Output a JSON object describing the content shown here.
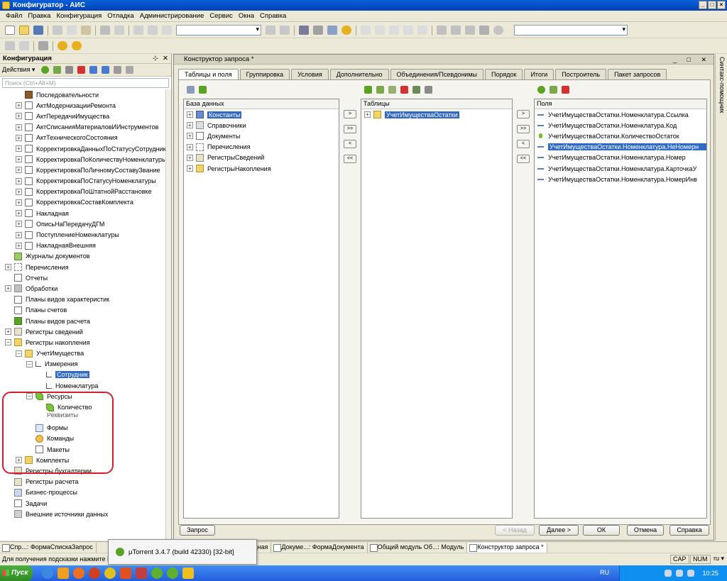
{
  "window": {
    "title": "Конфигуратор - АИС"
  },
  "menu": [
    "Файл",
    "Правка",
    "Конфигурация",
    "Отладка",
    "Администрирование",
    "Сервис",
    "Окна",
    "Справка"
  ],
  "left_panel": {
    "title": "Конфигурация",
    "actions_label": "Действия ▾",
    "search_placeholder": "Поиск (Ctrl+Alt+M)",
    "items": [
      "Последовательности",
      "АктМодернизацииРемонта",
      "АктПередачиИмущества",
      "АктСписанияМатериаловИИнструментов",
      "АктТехническогоСостояния",
      "КорректировкаДанныхПоСтатусуСотрудника",
      "КорректировкаПоКоличествуНоменклатуры",
      "КорректировкаПоЛичномуСоставуЗвание",
      "КорректировкаПоСтатусуНоменклатуры",
      "КорректировкаПоШтатнойРасстановке",
      "КорректировкаСоставКомплекта",
      "Накладная",
      "ОписьНаПередачуДГМ",
      "ПоступлениеНоменклатуры",
      "НакладнаяВнешняя",
      "Журналы документов",
      "Перечисления",
      "Отчеты",
      "Обработки",
      "Планы видов характеристик",
      "Планы счетов",
      "Планы видов расчета",
      "Регистры сведений",
      "Регистры накопления",
      "УчетИмущества",
      "Измерения",
      "Сотрудник",
      "Номенклатура",
      "Ресурсы",
      "Количество",
      "Реквизиты",
      "Формы",
      "Команды",
      "Макеты",
      "Комплекты",
      "Регистры бухгалтерии",
      "Регистры расчета",
      "Бизнес-процессы",
      "Задачи",
      "Внешние источники данных"
    ]
  },
  "query_window": {
    "title": "Конструктор запроса *",
    "tabs": [
      "Таблицы и поля",
      "Группировка",
      "Условия",
      "Дополнительно",
      "Объединения/Псевдонимы",
      "Порядок",
      "Итоги",
      "Построитель",
      "Пакет запросов"
    ],
    "database_header": "База данных",
    "database_items": [
      "Константы",
      "Справочники",
      "Документы",
      "Перечисления",
      "РегистрыСведений",
      "РегистрыНакопления"
    ],
    "tables_header": "Таблицы",
    "tables_items": [
      "УчетИмуществаОстатки"
    ],
    "fields_header": "Поля",
    "fields_items": [
      "УчетИмуществаОстатки.Номенклатура.Ссылка",
      "УчетИмуществаОстатки.Номенклатура.Код",
      "УчетИмуществаОстатки.КоличествоОстаток",
      "УчетИмуществаОстатки.Номенклатура.НеНомерн",
      "УчетИмуществаОстатки.Номенклатура.Номер",
      "УчетИмуществаОстатки.Номенклатура.КарточкаУ",
      "УчетИмуществаОстатки.Номенклатура.НомерИнв"
    ],
    "arrow_buttons": [
      ">",
      ">>",
      "<",
      "<<"
    ],
    "buttons": {
      "query": "Запрос",
      "back": "< Назад",
      "next": "Далее >",
      "ok": "ОК",
      "cancel": "Отмена",
      "help": "Справка"
    }
  },
  "side_tab": "Синтакс-помощник",
  "window_tabs": [
    "Спр...: ФормаСпискаЗапрос",
    "...дная",
    "Докуме...: ФормаДокумента",
    "Общий модуль Об...: Модуль",
    "Конструктор запроса *"
  ],
  "status": {
    "text": "Для получения подсказки нажмите F1",
    "cap": "CAP",
    "num": "NUM",
    "lang": "ru ▾"
  },
  "tooltip": {
    "text": "µTorrent 3.4.7  (build 42330) [32-bit]"
  },
  "taskbar": {
    "start": "Пуск",
    "lang": "RU",
    "clock": "10:25"
  }
}
